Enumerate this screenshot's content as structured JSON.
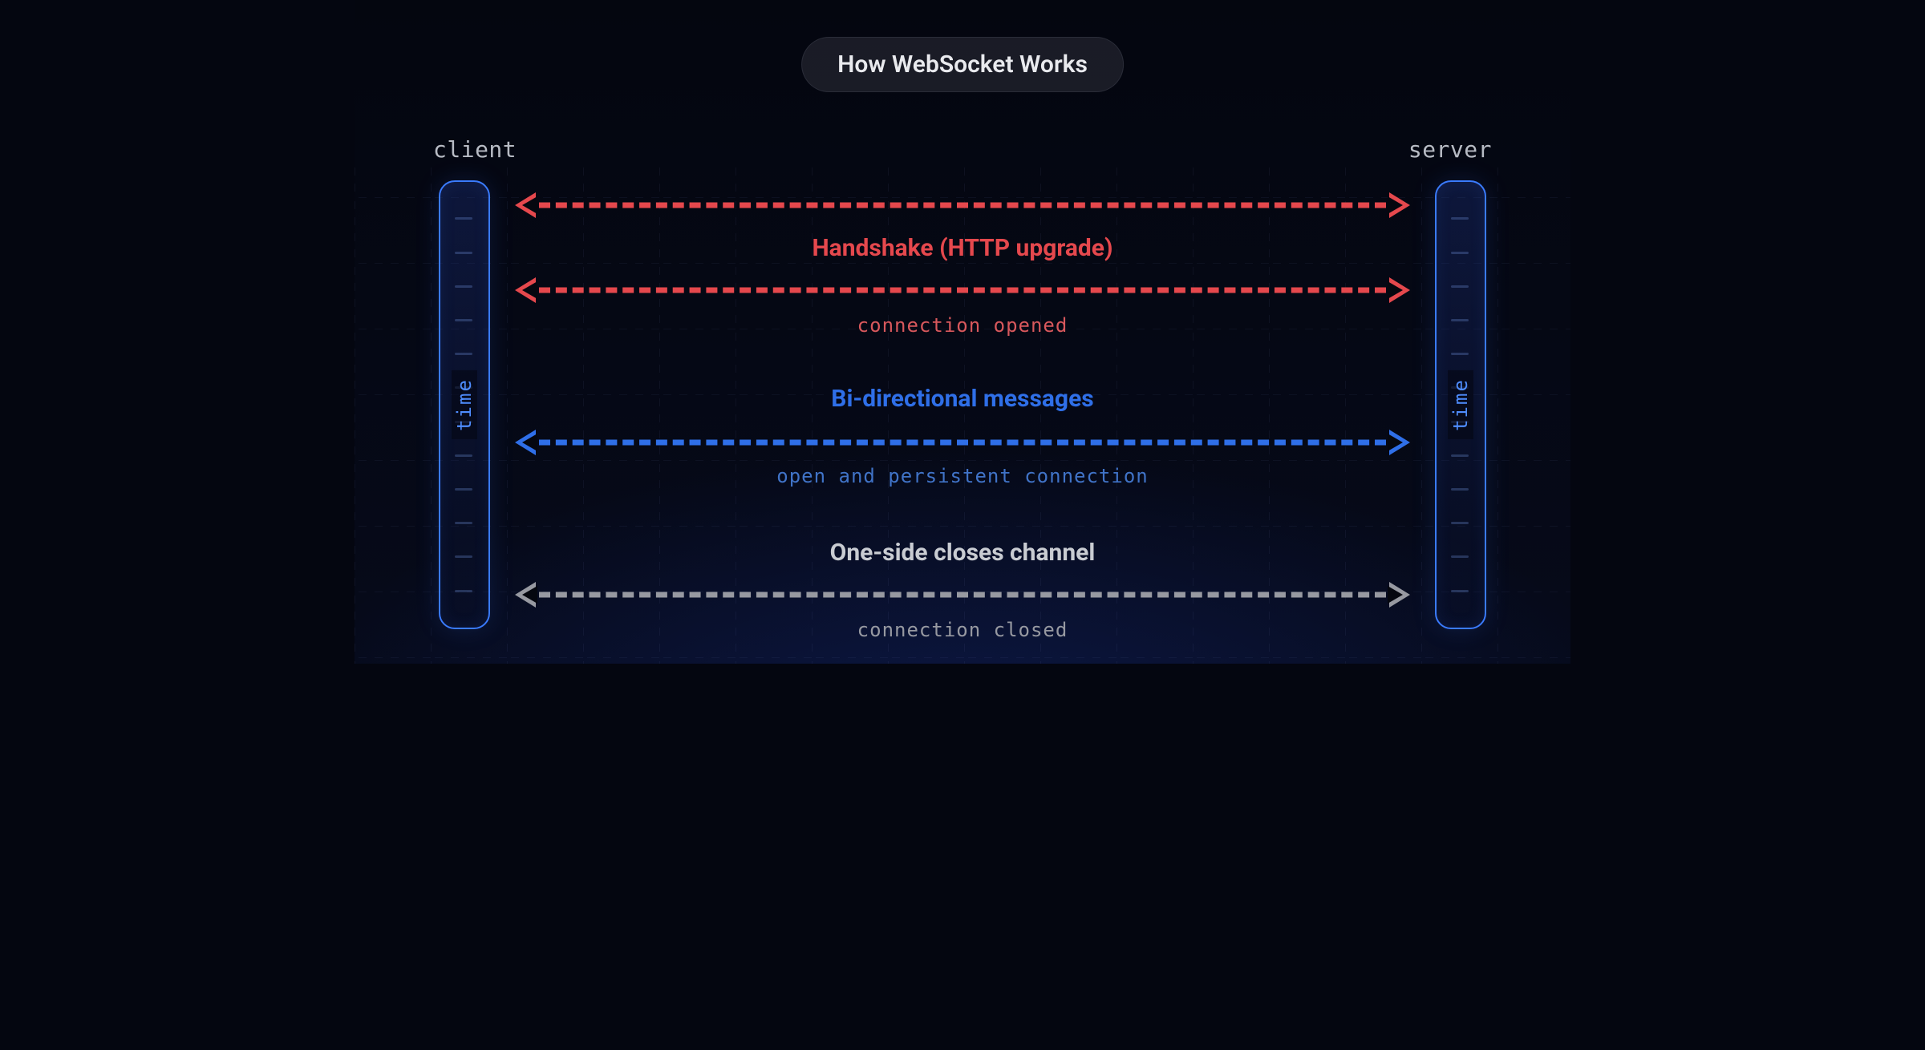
{
  "title": "How WebSocket Works",
  "endpoints": {
    "client": "client",
    "server": "server"
  },
  "timebar_label": "time",
  "colors": {
    "red": "#e5484d",
    "red_sub": "#d8585c",
    "blue": "#2f6fe8",
    "blue_sub": "#4073c7",
    "grey": "#c9ccd2",
    "grey_sub": "#9799a1"
  },
  "sections": {
    "handshake": {
      "title": "Handshake (HTTP upgrade)",
      "sub": "connection opened"
    },
    "bidir": {
      "title": "Bi-directional messages",
      "sub": "open and persistent connection"
    },
    "close": {
      "title": "One-side closes channel",
      "sub": "connection closed"
    }
  }
}
